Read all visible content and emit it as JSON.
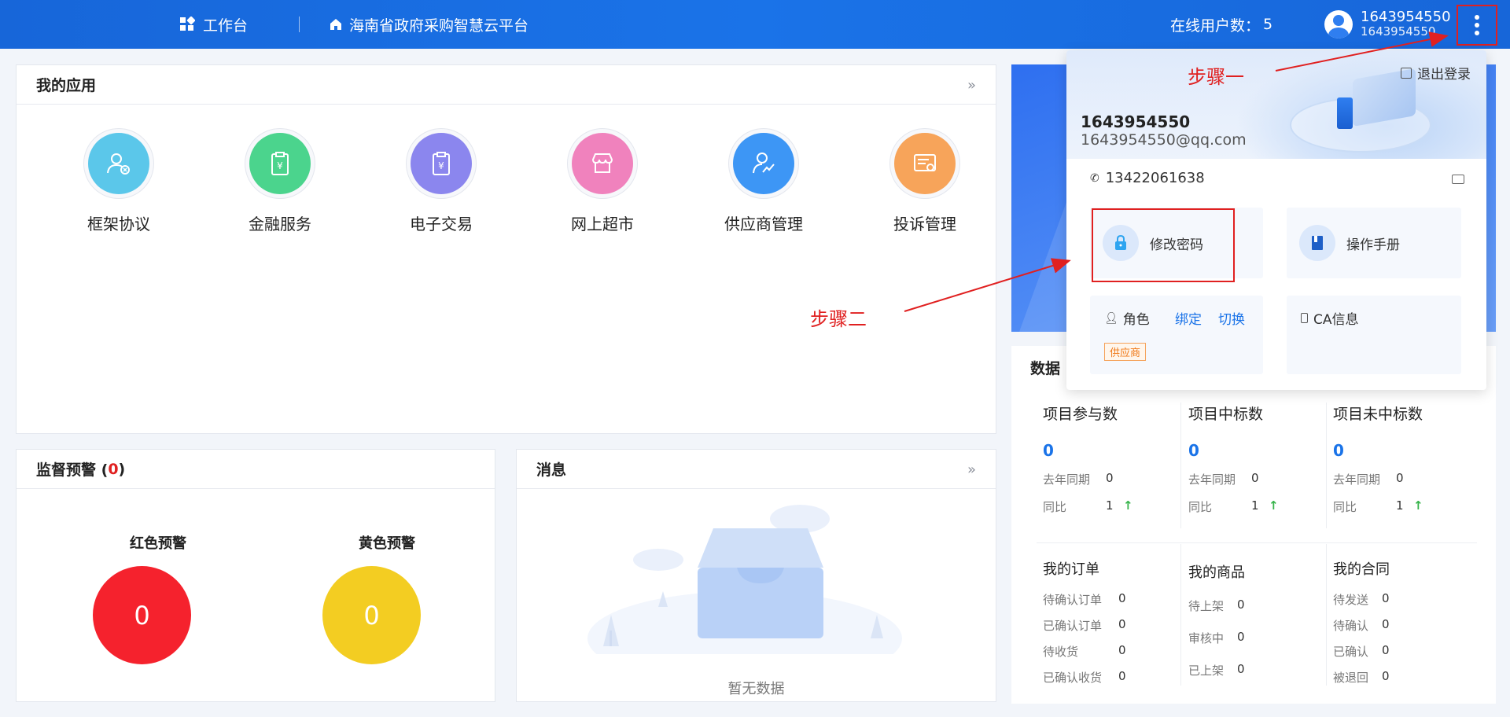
{
  "header": {
    "workbench": "工作台",
    "platform": "海南省政府采购智慧云平台",
    "online_label": "在线用户数：",
    "online_count": "5",
    "username": "1643954550",
    "username_sub": "1643954550",
    "more_icon": "vertical-dots-icon"
  },
  "apps": {
    "title": "我的应用",
    "items": [
      {
        "label": "框架协议",
        "icon": "user-cancel-icon",
        "color": "#5bc7ea"
      },
      {
        "label": "金融服务",
        "icon": "yen-clipboard-icon",
        "color": "#4bd48d"
      },
      {
        "label": "电子交易",
        "icon": "yen-clipboard-icon",
        "color": "#8b86ee"
      },
      {
        "label": "网上超市",
        "icon": "shop-icon",
        "color": "#f082bd"
      },
      {
        "label": "供应商管理",
        "icon": "user-chart-icon",
        "color": "#3d96f5"
      },
      {
        "label": "投诉管理",
        "icon": "complaint-icon",
        "color": "#f7a45a"
      }
    ]
  },
  "warning": {
    "title_prefix": "监督预警 (",
    "count": "0",
    "title_suffix": ")",
    "red_label": "红色预警",
    "red_value": "0",
    "red_color": "#f5222d",
    "yellow_label": "黄色预警",
    "yellow_value": "0",
    "yellow_color": "#f3cd22"
  },
  "messages": {
    "title": "消息",
    "empty": "暂无数据"
  },
  "data": {
    "title": "数据",
    "stats": [
      {
        "title": "项目参与数",
        "value": "0",
        "last_label": "去年同期",
        "last_value": "0",
        "ratio_label": "同比",
        "ratio_value": "1"
      },
      {
        "title": "项目中标数",
        "value": "0",
        "last_label": "去年同期",
        "last_value": "0",
        "ratio_label": "同比",
        "ratio_value": "1"
      },
      {
        "title": "项目未中标数",
        "value": "0",
        "last_label": "去年同期",
        "last_value": "0",
        "ratio_label": "同比",
        "ratio_value": "1"
      }
    ],
    "orders": {
      "title": "我的订单",
      "rows": [
        {
          "k": "待确认订单",
          "v": "0"
        },
        {
          "k": "已确认订单",
          "v": "0"
        },
        {
          "k": "待收货",
          "v": "0"
        },
        {
          "k": "已确认收货",
          "v": "0"
        }
      ]
    },
    "goods": {
      "title": "我的商品",
      "rows": [
        {
          "k": "待上架",
          "v": "0"
        },
        {
          "k": "审核中",
          "v": "0"
        },
        {
          "k": "已上架",
          "v": "0"
        }
      ]
    },
    "contracts": {
      "title": "我的合同",
      "rows": [
        {
          "k": "待发送",
          "v": "0"
        },
        {
          "k": "待确认",
          "v": "0"
        },
        {
          "k": "已确认",
          "v": "0"
        },
        {
          "k": "被退回",
          "v": "0"
        }
      ]
    }
  },
  "popup": {
    "logout": "退出登录",
    "name": "1643954550",
    "email": "1643954550@qq.com",
    "phone": "13422061638",
    "change_password": "修改密码",
    "manual": "操作手册",
    "role_label": "角色",
    "bind": "绑定",
    "switch": "切换",
    "role_tag": "供应商",
    "ca_info": "CA信息"
  },
  "annotations": {
    "step1": "步骤一",
    "step2": "步骤二"
  }
}
